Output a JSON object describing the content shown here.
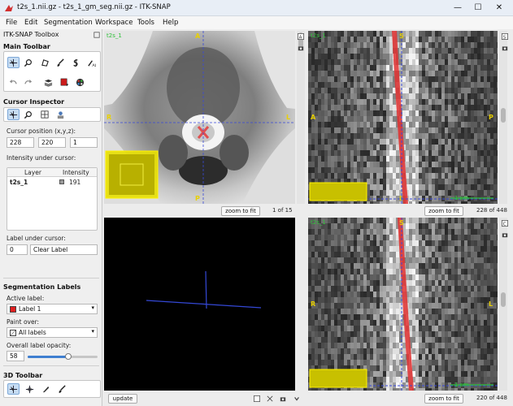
{
  "window": {
    "title": "t2s_1.nii.gz - t2s_1_gm_seg.nii.gz - ITK-SNAP",
    "minimize": "—",
    "maximize": "☐",
    "close": "✕"
  },
  "menu": [
    "File",
    "Edit",
    "Segmentation",
    "Workspace",
    "Tools",
    "Help"
  ],
  "sidebar": {
    "toolbox_title": "ITK-SNAP Toolbox",
    "main_toolbar_title": "Main Toolbar",
    "cursor_inspector_title": "Cursor Inspector",
    "cursor_position_label": "Cursor position (x,y,z):",
    "cursor_x": "228",
    "cursor_y": "220",
    "cursor_z": "1",
    "intensity_label": "Intensity under cursor:",
    "intensity_headers": [
      "Layer",
      "Intensity"
    ],
    "intensity_rows": [
      {
        "layer": "t2s_1",
        "value": "191"
      }
    ],
    "label_under_cursor_label": "Label under cursor:",
    "label_value": "0",
    "label_name": "Clear Label",
    "seg_labels_title": "Segmentation Labels",
    "active_label_label": "Active label:",
    "active_label": "Label 1",
    "active_label_color": "#e02020",
    "paint_over_label": "Paint over:",
    "paint_over": "All labels",
    "opacity_label": "Overall label opacity:",
    "opacity_value": "58",
    "opacity_fraction": 0.58,
    "toolbar_3d_title": "3D Toolbar"
  },
  "views": {
    "axial": {
      "name_tag": "t2s_1",
      "orient_top": "A",
      "orient_left": "R",
      "orient_right": "L",
      "orient_bottom": "P",
      "zoom_button": "zoom to fit",
      "slice": "1 of 15"
    },
    "sagittal": {
      "name_tag": "t2s_1",
      "orient_top": "S",
      "orient_left": "A",
      "orient_right": "P",
      "orient_bottom": "I",
      "scale": "1 cm",
      "zoom_button": "zoom to fit",
      "slice": "228 of 448"
    },
    "three_d": {
      "update_button": "update"
    },
    "coronal": {
      "name_tag": "t2s_1",
      "orient_top": "S",
      "orient_left": "R",
      "orient_right": "L",
      "scale": "1 cm",
      "zoom_button": "zoom to fit",
      "slice": "220 of 448"
    }
  },
  "icons": [
    "itk-snap-logo-icon",
    "crosshair-icon",
    "zoom-icon",
    "polygon-icon",
    "paintbrush-icon",
    "snake-icon",
    "annotation-icon",
    "undo-icon",
    "redo-icon",
    "layers-icon",
    "segmentation-icon",
    "palette-icon",
    "target-icon",
    "zoom-inspector-icon",
    "table-icon",
    "layer-inspector-icon",
    "window-layout-icon",
    "screenshot-icon"
  ]
}
